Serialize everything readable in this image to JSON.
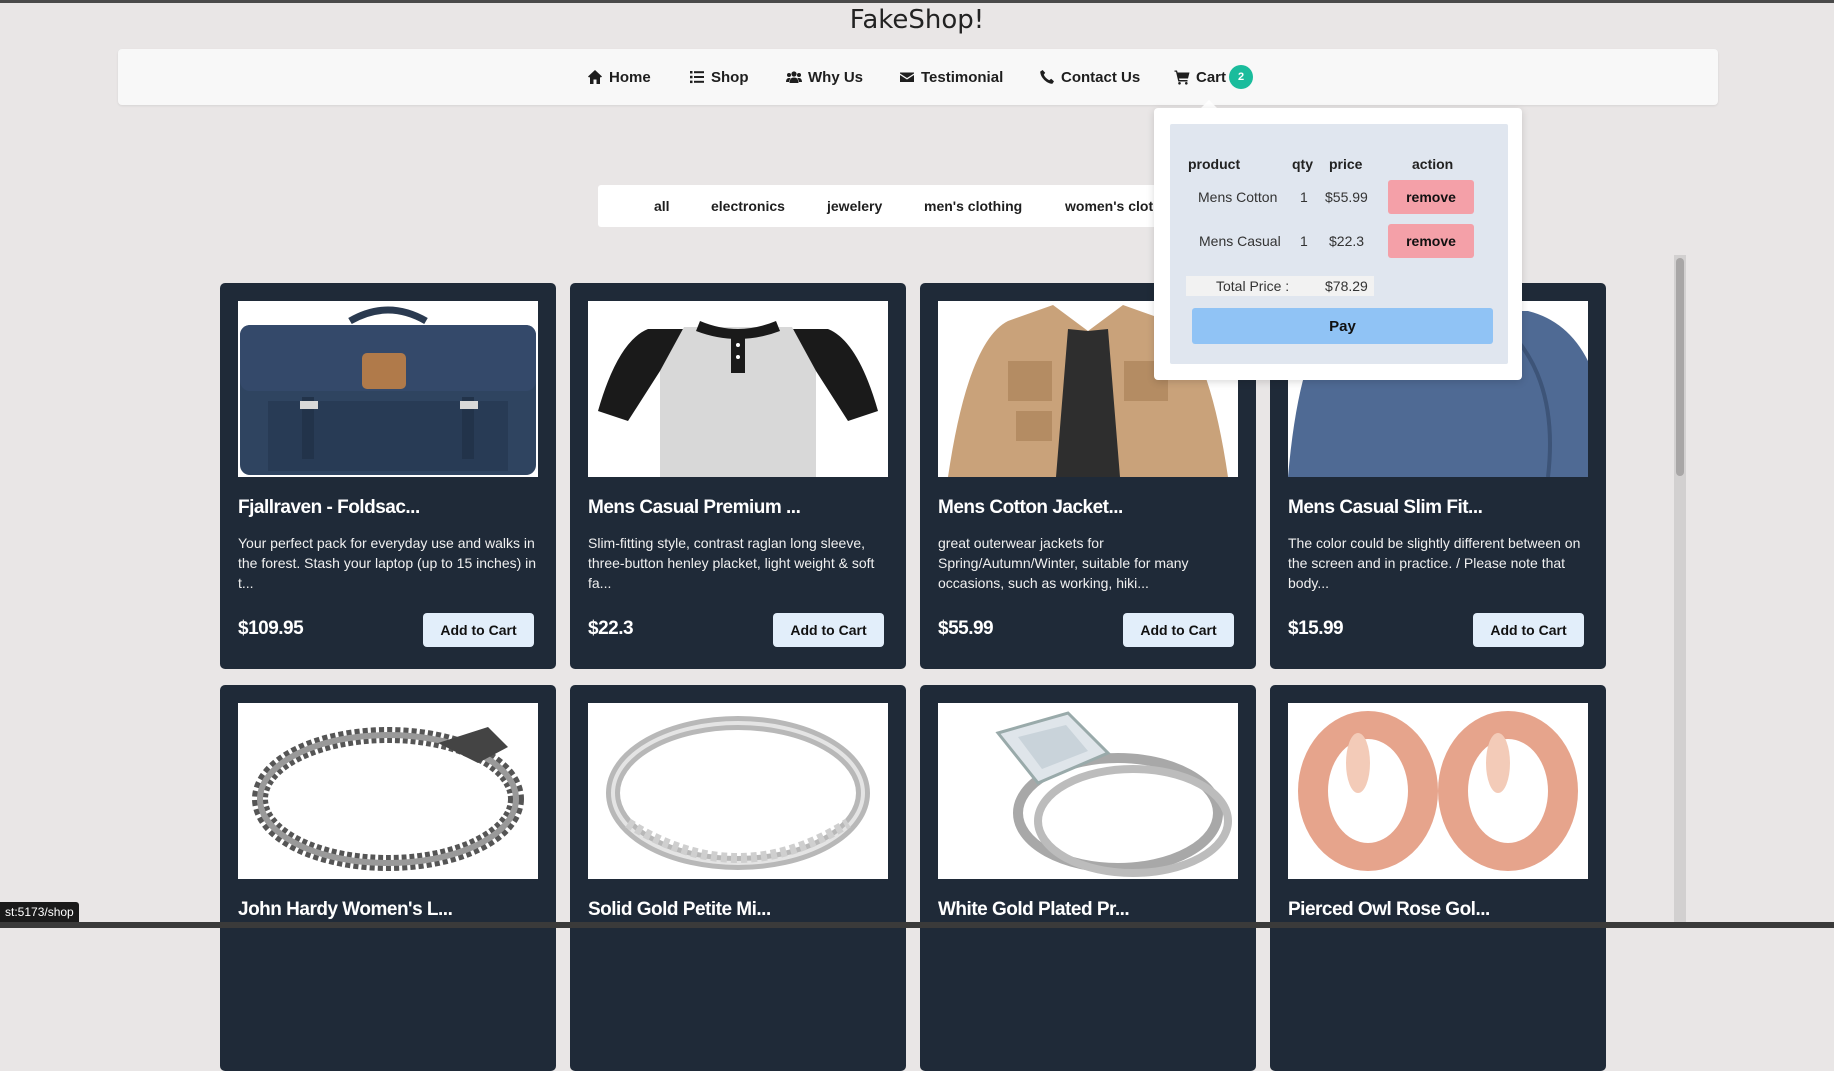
{
  "site": {
    "title": "FakeShop!"
  },
  "nav": {
    "items": [
      {
        "label": "Home",
        "icon": "home-icon"
      },
      {
        "label": "Shop",
        "icon": "list-icon"
      },
      {
        "label": "Why Us",
        "icon": "users-icon"
      },
      {
        "label": "Testimonial",
        "icon": "envelope-icon"
      },
      {
        "label": "Contact Us",
        "icon": "phone-icon"
      },
      {
        "label": "Cart",
        "icon": "cart-icon"
      }
    ],
    "cart_count": "2"
  },
  "filters": [
    "all",
    "electronics",
    "jewelery",
    "men's clothing",
    "women's clot"
  ],
  "products": [
    {
      "title": "Fjallraven - Foldsac...",
      "description": "Your perfect pack for everyday use and walks in the forest. Stash your laptop (up to 15 inches) in t...",
      "price": "$109.95",
      "button": "Add to Cart",
      "image": "backpack"
    },
    {
      "title": "Mens Casual Premium ...",
      "description": "Slim-fitting style, contrast raglan long sleeve, three-button henley placket, light weight & soft fa...",
      "price": "$22.3",
      "button": "Add to Cart",
      "image": "raglan-shirt"
    },
    {
      "title": "Mens Cotton Jacket...",
      "description": "great outerwear jackets for Spring/Autumn/Winter, suitable for many occasions, such as working, hiki...",
      "price": "$55.99",
      "button": "Add to Cart",
      "image": "cotton-jacket"
    },
    {
      "title": "Mens Casual Slim Fit...",
      "description": "The color could be slightly different between on the screen and in practice. / Please note that body...",
      "price": "$15.99",
      "button": "Add to Cart",
      "image": "slim-fit-shirt"
    },
    {
      "title": "John Hardy Women's L...",
      "image": "dragon-bracelet"
    },
    {
      "title": "Solid Gold Petite Mi...",
      "image": "silver-ring"
    },
    {
      "title": "White Gold Plated Pr...",
      "image": "diamond-rings"
    },
    {
      "title": "Pierced Owl Rose Gol...",
      "image": "rose-gold-plugs"
    }
  ],
  "cart": {
    "headers": {
      "product": "product",
      "qty": "qty",
      "price": "price",
      "action": "action"
    },
    "items": [
      {
        "product": "Mens Cotton",
        "qty": "1",
        "price": "$55.99",
        "action": "remove"
      },
      {
        "product": "Mens Casual",
        "qty": "1",
        "price": "$22.3",
        "action": "remove"
      }
    ],
    "total_label": "Total Price :",
    "total_value": "$78.29",
    "pay_label": "Pay"
  },
  "status_bar": {
    "url": "st:5173/shop"
  },
  "colors": {
    "card_bg": "#1f2a38",
    "badge": "#1abc9c",
    "remove": "#f4a0a8",
    "pay": "#90c3f5",
    "cart_panel": "#e0e6ef"
  }
}
